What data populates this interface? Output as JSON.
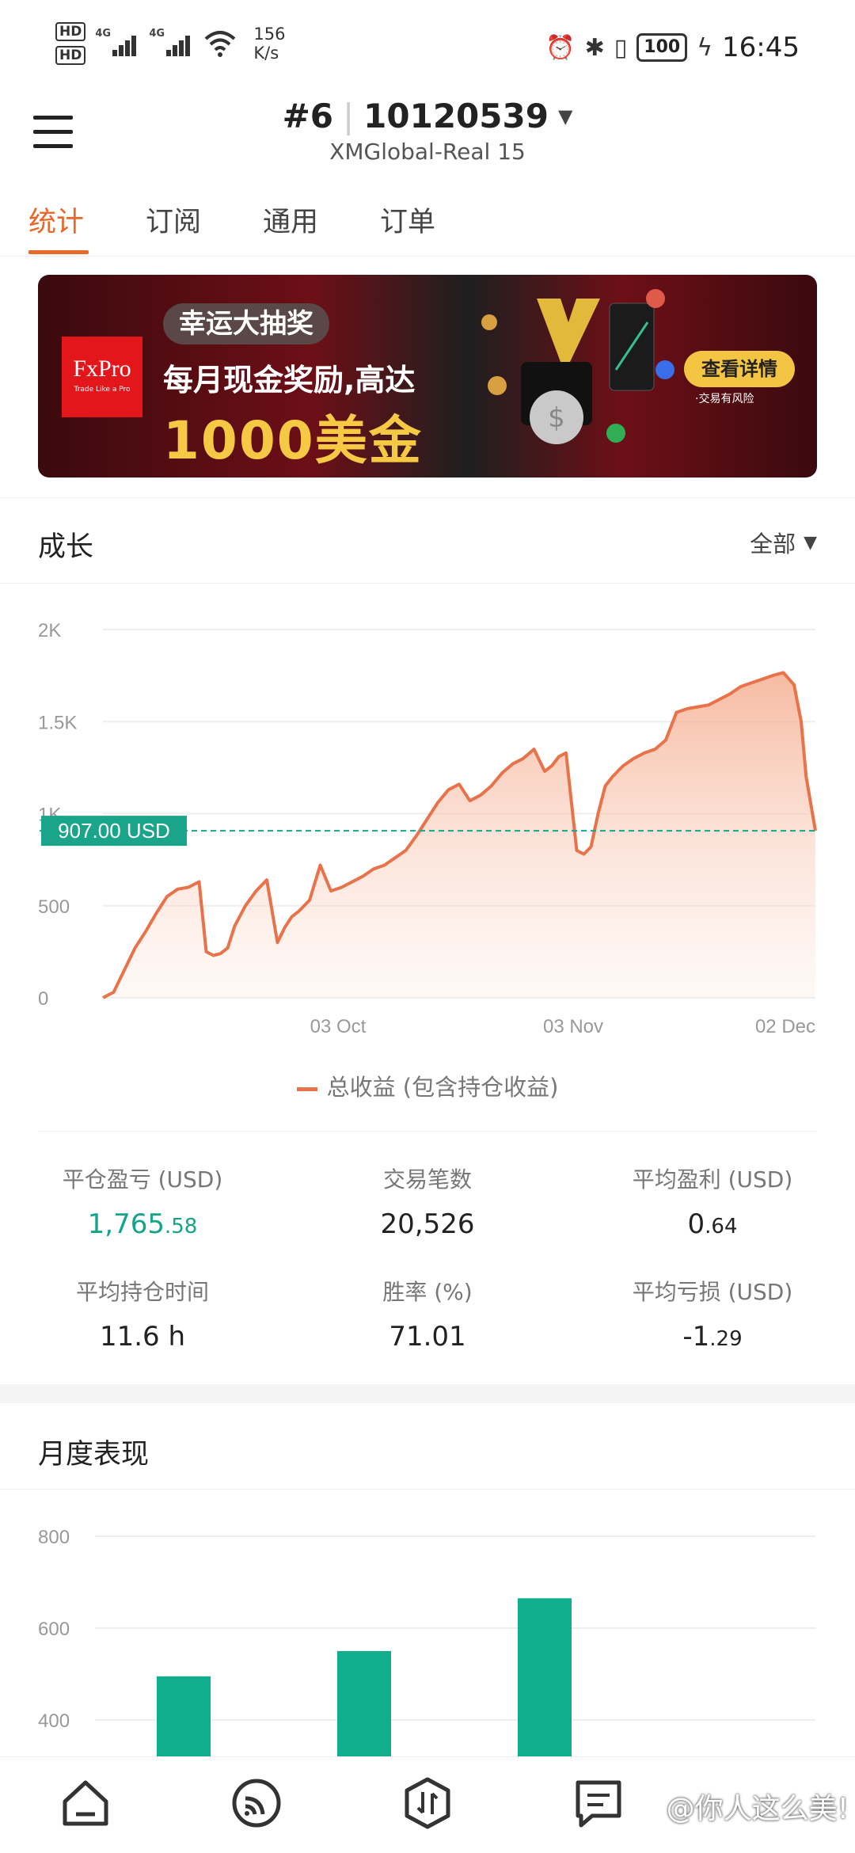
{
  "status_bar": {
    "hd1": "HD",
    "hd2": "HD",
    "sig1": "4G",
    "sig2": "4G",
    "speed_value": "156",
    "speed_unit": "K/s",
    "battery": "100",
    "time": "16:45"
  },
  "header": {
    "account_index": "#6",
    "account_number": "10120539",
    "server": "XMGlobal-Real 15"
  },
  "tabs": [
    {
      "label": "统计",
      "active": true
    },
    {
      "label": "订阅",
      "active": false
    },
    {
      "label": "通用",
      "active": false
    },
    {
      "label": "订单",
      "active": false
    }
  ],
  "banner": {
    "brand": "FxPro",
    "brand_tagline": "Trade Like a Pro",
    "pill": "幸运大抽奖",
    "line2": "每月现金奖励,高达",
    "line3": "1000美金",
    "cta": "查看详情",
    "risk": "·交易有风险"
  },
  "growth": {
    "title": "成长",
    "range_label": "全部",
    "legend": "总收益 (包含持仓收益)"
  },
  "chart_data": [
    {
      "type": "area",
      "ylabel": "",
      "xlabel": "",
      "ylim": [
        0,
        2000
      ],
      "yticks": [
        "2K",
        "1.5K",
        "1K",
        "500",
        "0"
      ],
      "ytick_values": [
        2000,
        1500,
        1000,
        500,
        0
      ],
      "xticks": [
        "03 Oct",
        "03 Nov",
        "02 Dec"
      ],
      "xlim": [
        0,
        100
      ],
      "xtick_positions": [
        33,
        66,
        100
      ],
      "reference_line": {
        "value": 907,
        "label": "907.00 USD",
        "color": "#1aa58a"
      },
      "series": [
        {
          "color": "#e8734a",
          "x": [
            0,
            1.5,
            3,
            4.5,
            6,
            7.5,
            9,
            10.5,
            12,
            13.5,
            14.5,
            15.5,
            16.5,
            17.5,
            18.5,
            20,
            21.5,
            23,
            24.5,
            25.5,
            26.5,
            27.5,
            29,
            30.5,
            32,
            33.5,
            34.5,
            35.5,
            36.5,
            38,
            39.5,
            41,
            42.5,
            44,
            45.5,
            47,
            48.5,
            50,
            51.5,
            53,
            54.5,
            56,
            57.5,
            59,
            60.5,
            62,
            63,
            64,
            65,
            66.5,
            67.5,
            68.5,
            69.5,
            70.5,
            71.5,
            73,
            74.5,
            76,
            77.5,
            79,
            80.5,
            82,
            83.5,
            85,
            86.5,
            88,
            89.5,
            91,
            92.5,
            94,
            95.5,
            97,
            98,
            98.7,
            100
          ],
          "values": [
            0,
            30,
            150,
            270,
            360,
            460,
            550,
            590,
            600,
            630,
            250,
            230,
            240,
            270,
            390,
            500,
            580,
            640,
            300,
            380,
            440,
            470,
            530,
            720,
            580,
            600,
            620,
            640,
            660,
            700,
            720,
            760,
            800,
            880,
            970,
            1060,
            1130,
            1160,
            1070,
            1100,
            1150,
            1220,
            1270,
            1300,
            1350,
            1230,
            1260,
            1310,
            1330,
            800,
            780,
            820,
            1000,
            1150,
            1200,
            1260,
            1300,
            1330,
            1350,
            1400,
            1550,
            1570,
            1580,
            1590,
            1620,
            1650,
            1690,
            1710,
            1730,
            1750,
            1766,
            1700,
            1500,
            1200,
            907
          ]
        }
      ]
    },
    {
      "type": "bar",
      "ylim": [
        300,
        800
      ],
      "yticks": [
        "800",
        "600",
        "400"
      ],
      "ytick_values": [
        800,
        600,
        400
      ],
      "categories": [
        "",
        "",
        ""
      ],
      "values": [
        495,
        550,
        665
      ],
      "color": "#0fae8c"
    }
  ],
  "stats": [
    {
      "label": "平仓盈亏 (USD)",
      "value_main": "1,765",
      "value_small": ".58",
      "green": true
    },
    {
      "label": "交易笔数",
      "value_main": "20,526",
      "value_small": "",
      "green": false
    },
    {
      "label": "平均盈利 (USD)",
      "value_main": "0",
      "value_small": ".64",
      "green": false
    },
    {
      "label": "平均持仓时间",
      "value_main": "11.6 h",
      "value_small": "",
      "green": false
    },
    {
      "label": "胜率 (%)",
      "value_main": "71.01",
      "value_small": "",
      "green": false
    },
    {
      "label": "平均亏损 (USD)",
      "value_main": "-1",
      "value_small": ".29",
      "green": false
    }
  ],
  "monthly": {
    "title": "月度表现"
  },
  "bottom_nav": {
    "items": [
      "home-icon",
      "feed-icon",
      "trade-icon",
      "messages-icon"
    ],
    "watermark": "@你人这么美!"
  }
}
